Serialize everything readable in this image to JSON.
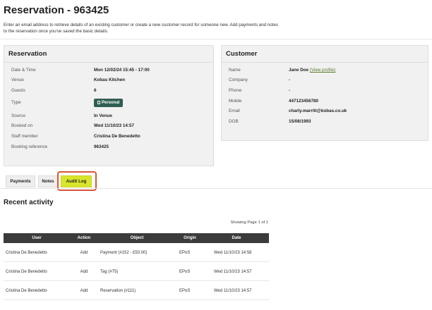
{
  "page": {
    "title": "Reservation - 963425",
    "intro_line1": "Enter an email address to retrieve details of an existing customer or create a new customer record for someone new. Add payments and notes",
    "intro_line2": "to the reservation once you've saved the basic details."
  },
  "reservation": {
    "heading": "Reservation",
    "date_time_label": "Date & Time",
    "date_time_value": "Mon 12/02/24 15:45 - 17:00",
    "venue_label": "Venue",
    "venue_value": "Kobas Kitchen",
    "guests_label": "Guests",
    "guests_value": "6",
    "type_label": "Type",
    "type_value": "Personal",
    "source_label": "Source",
    "source_value": "In Venue",
    "booked_on_label": "Booked on",
    "booked_on_value": "Wed 11/10/23 14:57",
    "staff_label": "Staff member",
    "staff_value": "Cristina De Benedetto",
    "ref_label": "Booking reference",
    "ref_value": "963425"
  },
  "customer": {
    "heading": "Customer",
    "name_label": "Name",
    "name_value": "Jane Doe",
    "view_profile": "(View profile)",
    "company_label": "Company",
    "company_value": "-",
    "phone_label": "Phone",
    "phone_value": "-",
    "mobile_label": "Mobile",
    "mobile_value": "447123456780",
    "email_label": "Email",
    "email_value": "charly.marritt@kobas.co.uk",
    "dob_label": "DOB",
    "dob_value": "15/08/1993"
  },
  "tabs": {
    "payments": "Payments",
    "notes": "Notes",
    "audit_log": "Audit Log"
  },
  "activity": {
    "title": "Recent activity",
    "paging": "Showing Page 1 of 1",
    "headers": {
      "user": "User",
      "action": "Action",
      "object": "Object",
      "origin": "Origin",
      "date": "Date"
    },
    "rows": [
      {
        "user": "Cristina De Benedetto",
        "action": "Add",
        "object": "Payment (#152 - £50.00)",
        "origin": "EPoS",
        "date": "Wed 11/10/23 14:58"
      },
      {
        "user": "Cristina De Benedetto",
        "action": "Add",
        "object": "Tag (#75)",
        "origin": "EPoS",
        "date": "Wed 11/10/23 14:57"
      },
      {
        "user": "Cristina De Benedetto",
        "action": "Add",
        "object": "Reservation (#111)",
        "origin": "EPoS",
        "date": "Wed 11/10/23 14:57"
      }
    ]
  },
  "colors": {
    "badge_bg": "#2f5e52",
    "active_tab": "#d8e52b",
    "highlight_ring": "#d8553a",
    "table_header": "#3b3b3b"
  },
  "icons": {
    "type_badge": "tag-icon"
  }
}
